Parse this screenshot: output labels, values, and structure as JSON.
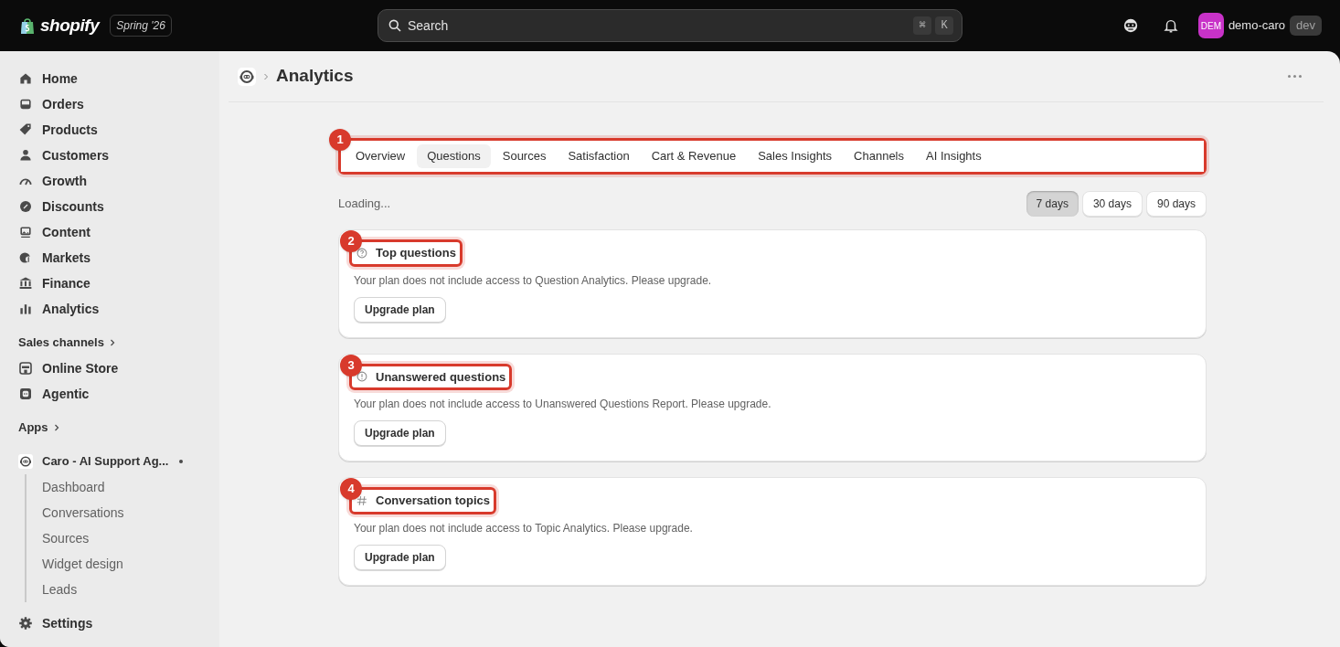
{
  "topbar": {
    "logo_text": "shopify",
    "edition": "Spring '26",
    "search": {
      "placeholder": "Search",
      "shortcut": [
        "⌘",
        "K"
      ]
    },
    "store": {
      "avatar": "DEM",
      "name": "demo-caro",
      "badge": "dev"
    }
  },
  "sidebar": {
    "items": [
      {
        "label": "Home"
      },
      {
        "label": "Orders"
      },
      {
        "label": "Products"
      },
      {
        "label": "Customers"
      },
      {
        "label": "Growth"
      },
      {
        "label": "Discounts"
      },
      {
        "label": "Content"
      },
      {
        "label": "Markets"
      },
      {
        "label": "Finance"
      },
      {
        "label": "Analytics"
      }
    ],
    "sales_channels": {
      "label": "Sales channels",
      "items": [
        {
          "label": "Online Store"
        },
        {
          "label": "Agentic"
        }
      ]
    },
    "apps": {
      "label": "Apps",
      "app": {
        "name": "Caro - AI Support Ag...",
        "children": [
          {
            "label": "Dashboard"
          },
          {
            "label": "Conversations"
          },
          {
            "label": "Sources"
          },
          {
            "label": "Widget design"
          },
          {
            "label": "Leads"
          }
        ]
      }
    },
    "settings": {
      "label": "Settings"
    }
  },
  "page": {
    "title": "Analytics"
  },
  "tabs": {
    "annotation": "1",
    "items": [
      {
        "label": "Overview",
        "selected": false
      },
      {
        "label": "Questions",
        "selected": true
      },
      {
        "label": "Sources",
        "selected": false
      },
      {
        "label": "Satisfaction",
        "selected": false
      },
      {
        "label": "Cart & Revenue",
        "selected": false
      },
      {
        "label": "Sales Insights",
        "selected": false
      },
      {
        "label": "Channels",
        "selected": false
      },
      {
        "label": "AI Insights",
        "selected": false
      }
    ]
  },
  "status": "Loading...",
  "ranges": [
    {
      "label": "7 days",
      "selected": true
    },
    {
      "label": "30 days",
      "selected": false
    },
    {
      "label": "90 days",
      "selected": false
    }
  ],
  "cards": [
    {
      "kind": "question",
      "annotation": "2",
      "title": "Top questions",
      "message": "Your plan does not include access to Question Analytics. Please upgrade.",
      "button": "Upgrade plan"
    },
    {
      "kind": "alert",
      "annotation": "3",
      "title": "Unanswered questions",
      "message": "Your plan does not include access to Unanswered Questions Report. Please upgrade.",
      "button": "Upgrade plan"
    },
    {
      "kind": "hash",
      "annotation": "4",
      "title": "Conversation topics",
      "message": "Your plan does not include access to Topic Analytics. Please upgrade.",
      "button": "Upgrade plan"
    }
  ]
}
